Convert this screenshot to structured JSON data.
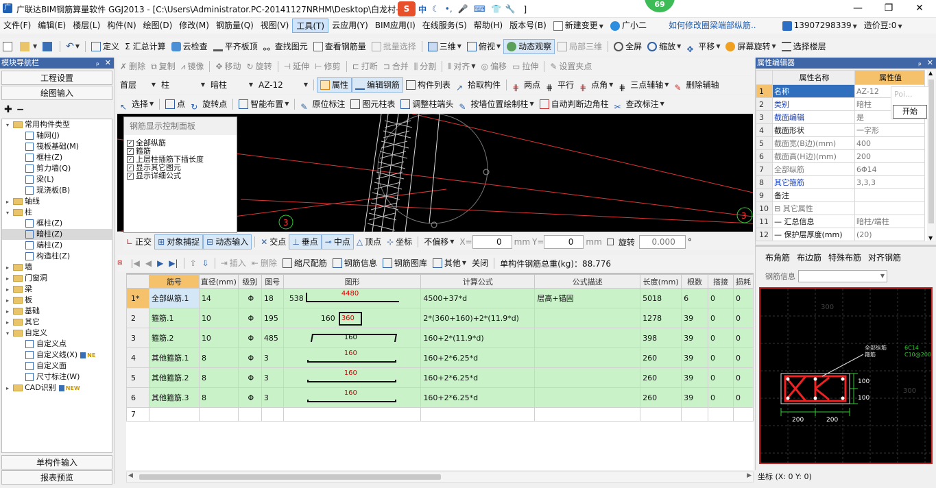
{
  "window": {
    "title": "广联达BIM钢筋算量软件 GGJ2013 - [C:\\Users\\Administrator.PC-20141127NRHM\\Desktop\\白龙村-",
    "title_tail": "]",
    "badge": "69",
    "ime_label": "中"
  },
  "menu": [
    "文件(F)",
    "编辑(E)",
    "楼层(L)",
    "构件(N)",
    "绘图(D)",
    "修改(M)",
    "钢筋量(Q)",
    "视图(V)",
    "工具(T)",
    "云应用(Y)",
    "BIM应用(I)",
    "在线服务(S)",
    "帮助(H)",
    "版本号(B)",
    "新建变更",
    "广小二",
    "如何修改圈梁端部纵筋..",
    "13907298339",
    "造价豆:0"
  ],
  "toolbar1": [
    "定义",
    "汇总计算",
    "云检查",
    "平齐板顶",
    "查找图元",
    "查看钢筋量",
    "批量选择",
    "三维",
    "俯视",
    "动态观察",
    "局部三维",
    "全屏",
    "缩放",
    "平移",
    "屏幕旋转",
    "选择楼层"
  ],
  "toolbar2": [
    "删除",
    "复制",
    "镜像",
    "移动",
    "旋转",
    "延伸",
    "修剪",
    "打断",
    "合并",
    "分割",
    "对齐",
    "偏移",
    "拉伸",
    "设置夹点"
  ],
  "toolbar3": {
    "floor": "首层",
    "type": "柱",
    "subtype": "暗柱",
    "name": "AZ-12",
    "items": [
      "属性",
      "编辑钢筋",
      "构件列表",
      "拾取构件",
      "两点",
      "平行",
      "点角",
      "三点辅轴",
      "删除辅轴"
    ]
  },
  "toolbar4": [
    "选择",
    "点",
    "旋转点",
    "智能布置",
    "原位标注",
    "图元柱表",
    "调整柱端头",
    "按墙位置绘制柱",
    "自动判断边角柱",
    "查改标注"
  ],
  "left_panel": {
    "title": "模块导航栏",
    "buttons": [
      "工程设置",
      "绘图输入"
    ],
    "bottom_buttons": [
      "单构件输入",
      "报表预览"
    ],
    "tree": [
      {
        "level": 0,
        "expand": "⊟",
        "folder": true,
        "label": "常用构件类型"
      },
      {
        "level": 1,
        "label": "轴网(J)"
      },
      {
        "level": 1,
        "label": "筏板基础(M)"
      },
      {
        "level": 1,
        "label": "框柱(Z)"
      },
      {
        "level": 1,
        "label": "剪力墙(Q)"
      },
      {
        "level": 1,
        "label": "梁(L)"
      },
      {
        "level": 1,
        "label": "现浇板(B)"
      },
      {
        "level": 0,
        "expand": "⊞",
        "folder": true,
        "label": "轴线"
      },
      {
        "level": 0,
        "expand": "⊟",
        "folder": true,
        "label": "柱"
      },
      {
        "level": 1,
        "label": "框柱(Z)"
      },
      {
        "level": 1,
        "label": "暗柱(Z)",
        "selected": true
      },
      {
        "level": 1,
        "label": "端柱(Z)"
      },
      {
        "level": 1,
        "label": "构造柱(Z)"
      },
      {
        "level": 0,
        "expand": "⊞",
        "folder": true,
        "label": "墙"
      },
      {
        "level": 0,
        "expand": "⊞",
        "folder": true,
        "label": "门窗洞"
      },
      {
        "level": 0,
        "expand": "⊞",
        "folder": true,
        "label": "梁"
      },
      {
        "level": 0,
        "expand": "⊞",
        "folder": true,
        "label": "板"
      },
      {
        "level": 0,
        "expand": "⊞",
        "folder": true,
        "label": "基础"
      },
      {
        "level": 0,
        "expand": "⊞",
        "folder": true,
        "label": "其它"
      },
      {
        "level": 0,
        "expand": "⊟",
        "folder": true,
        "label": "自定义"
      },
      {
        "level": 1,
        "label": "自定义点"
      },
      {
        "level": 1,
        "label": "自定义线(X)",
        "badge": "NE"
      },
      {
        "level": 1,
        "label": "自定义面"
      },
      {
        "level": 1,
        "label": "尺寸标注(W)"
      },
      {
        "level": 0,
        "expand": "⊞",
        "folder": true,
        "label": "CAD识别",
        "badge": "NEW"
      }
    ]
  },
  "rebar_panel": {
    "title": "钢筋显示控制面板",
    "items": [
      "全部纵筋",
      "箍筋",
      "上层柱插筋下插长度",
      "显示其它图元",
      "显示详细公式"
    ]
  },
  "canvas_labels": {
    "axis3": "3"
  },
  "snap_bar": {
    "items": [
      "正交",
      "对象捕捉",
      "动态输入",
      "交点",
      "垂点",
      "中点",
      "顶点",
      "坐标"
    ],
    "offset": "不偏移",
    "x_label": "X=",
    "x_value": "0",
    "y_label": "Y=",
    "y_value": "0",
    "unit": "mm",
    "rotate_label": "旋转",
    "rotate_value": "0.000",
    "degree": "°"
  },
  "grid_toolbar": {
    "items": [
      "插入",
      "删除",
      "缩尺配筋",
      "钢筋信息",
      "钢筋图库",
      "其他",
      "关闭"
    ],
    "total": "单构件钢筋总重(kg)：88.776"
  },
  "grid": {
    "headers": [
      "",
      "筋号",
      "直径(mm)",
      "级别",
      "图号",
      "图形",
      "计算公式",
      "公式描述",
      "长度(mm)",
      "根数",
      "搭接",
      "损耗"
    ],
    "rows": [
      {
        "no": "1*",
        "name": "全部纵筋.1",
        "dia": "14",
        "grade": "Φ",
        "fig": "18",
        "shape": "538 | 4480",
        "formula": "4500+37*d",
        "desc": "层高+锚固",
        "len": "5018",
        "count": "6",
        "lap": "0",
        "loss": "0"
      },
      {
        "no": "2",
        "name": "箍筋.1",
        "dia": "10",
        "grade": "Φ",
        "fig": "195",
        "shape": "160 | 360",
        "formula": "2*(360+160)+2*(11.9*d)",
        "desc": "",
        "len": "1278",
        "count": "39",
        "lap": "0",
        "loss": "0"
      },
      {
        "no": "3",
        "name": "箍筋.2",
        "dia": "10",
        "grade": "Φ",
        "fig": "485",
        "shape": "160",
        "formula": "160+2*(11.9*d)",
        "desc": "",
        "len": "398",
        "count": "39",
        "lap": "0",
        "loss": "0"
      },
      {
        "no": "4",
        "name": "其他箍筋.1",
        "dia": "8",
        "grade": "Φ",
        "fig": "3",
        "shape": "160",
        "formula": "160+2*6.25*d",
        "desc": "",
        "len": "260",
        "count": "39",
        "lap": "0",
        "loss": "0"
      },
      {
        "no": "5",
        "name": "其他箍筋.2",
        "dia": "8",
        "grade": "Φ",
        "fig": "3",
        "shape": "160",
        "formula": "160+2*6.25*d",
        "desc": "",
        "len": "260",
        "count": "39",
        "lap": "0",
        "loss": "0"
      },
      {
        "no": "6",
        "name": "其他箍筋.3",
        "dia": "8",
        "grade": "Φ",
        "fig": "3",
        "shape": "160",
        "formula": "160+2*6.25*d",
        "desc": "",
        "len": "260",
        "count": "39",
        "lap": "0",
        "loss": "0"
      },
      {
        "no": "7",
        "name": "",
        "dia": "",
        "grade": "",
        "fig": "",
        "shape": "",
        "formula": "",
        "desc": "",
        "len": "",
        "count": "",
        "lap": "",
        "loss": ""
      }
    ]
  },
  "property_editor": {
    "title": "属性编辑器",
    "col_name": "属性名称",
    "col_value": "属性值",
    "rows": [
      {
        "no": "1",
        "name": "名称",
        "value": "AZ-12",
        "style": "sel"
      },
      {
        "no": "2",
        "name": "类别",
        "value": "暗柱",
        "style": "blue"
      },
      {
        "no": "3",
        "name": "截面编辑",
        "value": "是",
        "style": "blue"
      },
      {
        "no": "4",
        "name": "截面形状",
        "value": "一字形",
        "style": ""
      },
      {
        "no": "5",
        "name": "截面宽(B边)(mm)",
        "value": "400",
        "style": "gray"
      },
      {
        "no": "6",
        "name": "截面高(H边)(mm)",
        "value": "200",
        "style": "gray"
      },
      {
        "no": "7",
        "name": "全部纵筋",
        "value": "6Φ14",
        "style": "gray"
      },
      {
        "no": "8",
        "name": "其它箍筋",
        "value": "3,3,3",
        "style": "blue"
      },
      {
        "no": "9",
        "name": "备注",
        "value": "",
        "style": ""
      },
      {
        "no": "10",
        "name": "⊟ 其它属性",
        "value": "",
        "style": "gray"
      },
      {
        "no": "11",
        "name": "— 汇总信息",
        "value": "暗柱/端柱",
        "style": ""
      },
      {
        "no": "12",
        "name": "— 保护层厚度(mm)",
        "value": "(20)",
        "style": ""
      }
    ],
    "popup_hint": "Poi...",
    "popup_button": "开始"
  },
  "section_tabs": [
    "布角筋",
    "布边筋",
    "特殊布筋",
    "对齐钢筋"
  ],
  "section_info_label": "钢筋信息",
  "section": {
    "label1": "全部纵筋",
    "label2": "箍筋",
    "spec1": "6C14",
    "spec2": "C10@200",
    "d1": "200",
    "d2": "200",
    "h1": "100",
    "h2": "100",
    "ghost_top": "300",
    "ghost_right": "300"
  },
  "status": "坐标 (X: 0 Y: 0)"
}
